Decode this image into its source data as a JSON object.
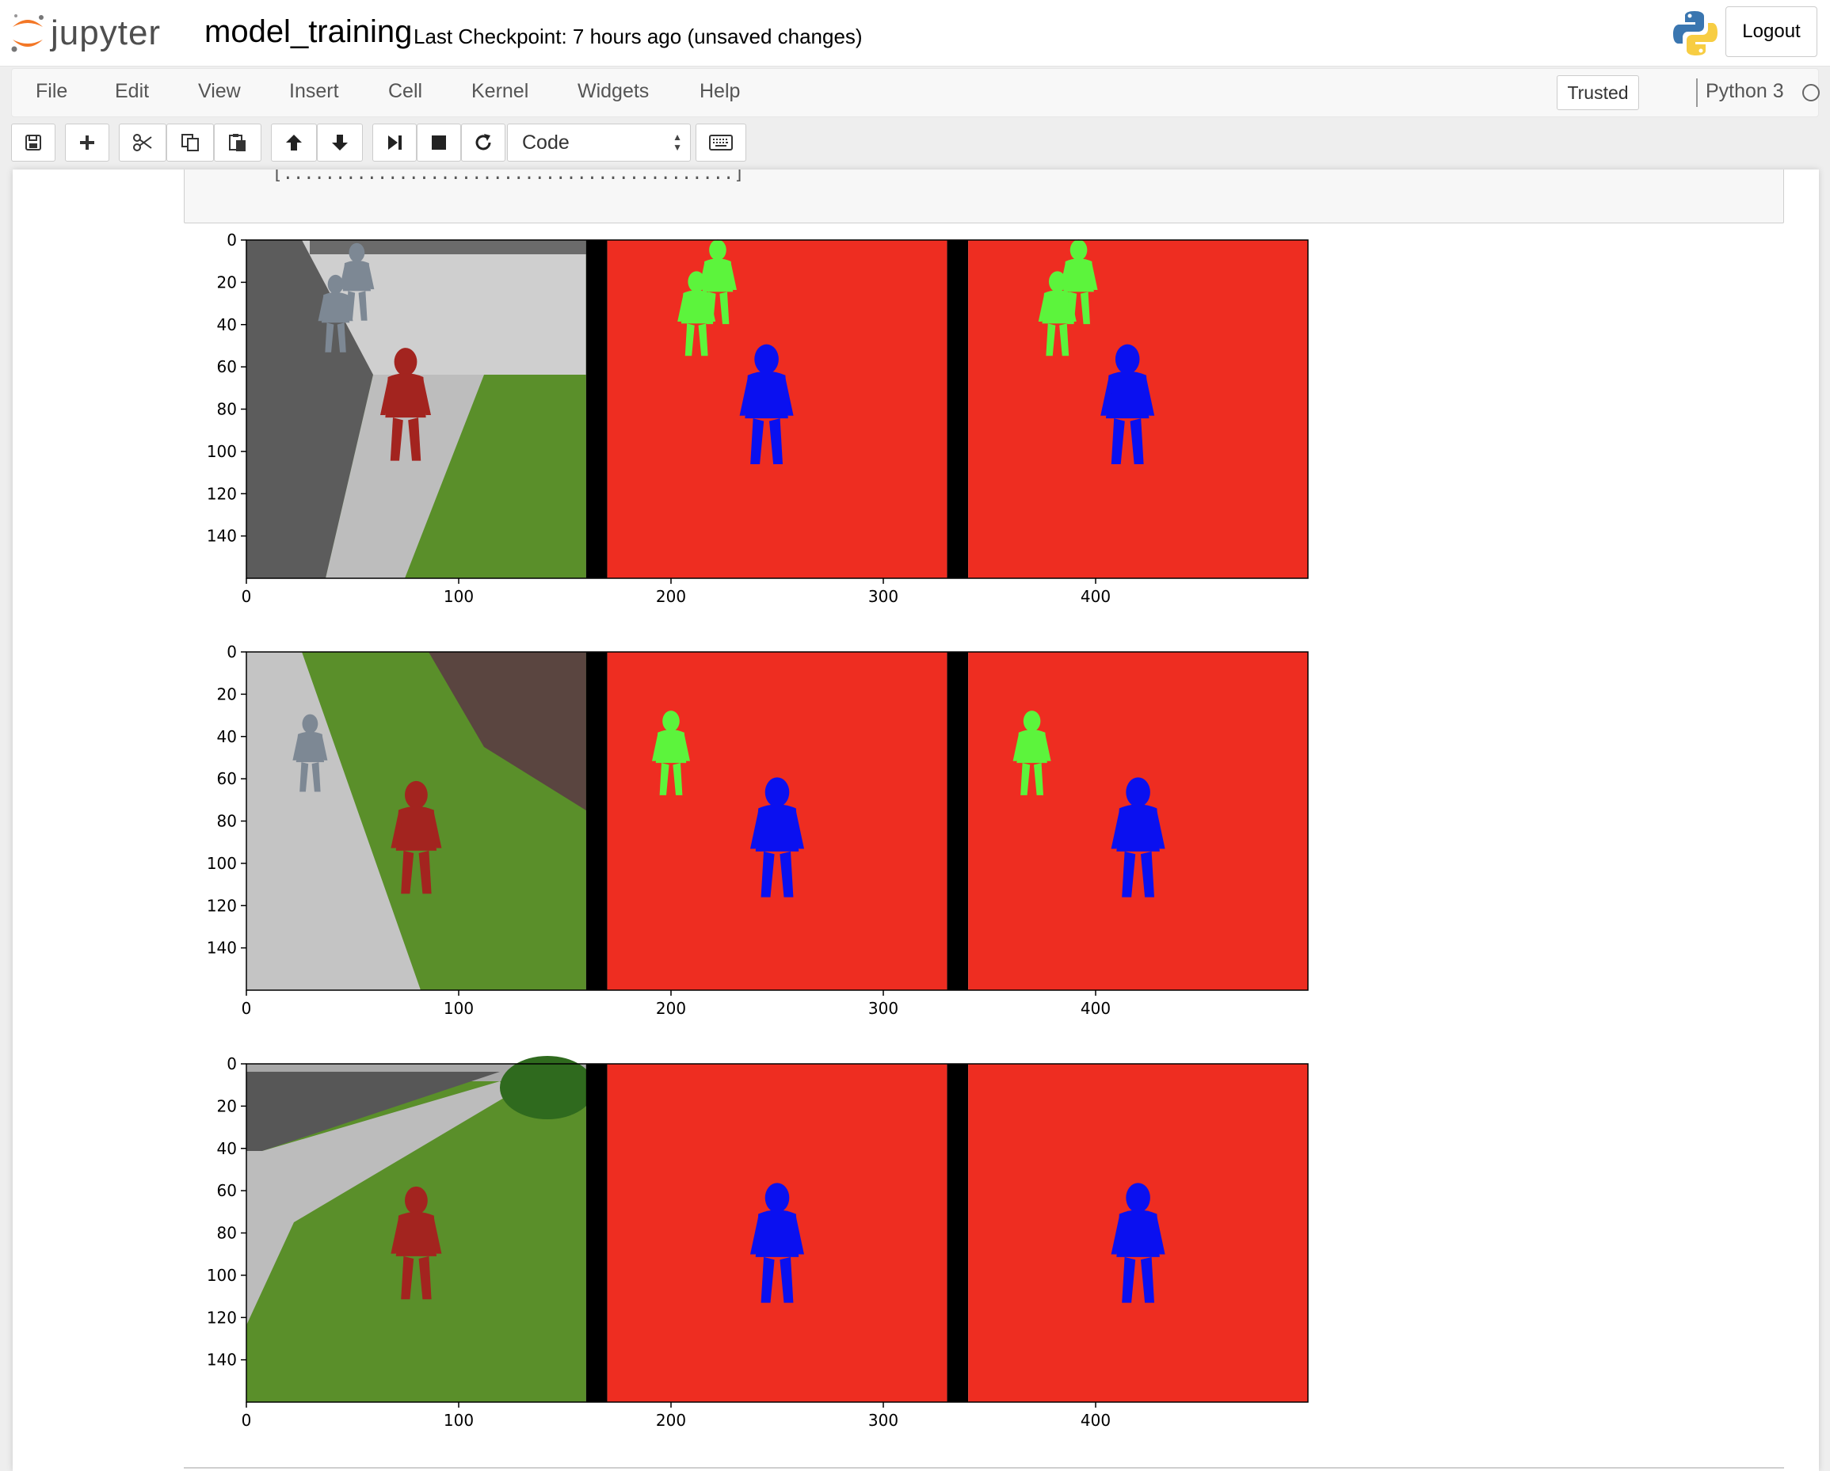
{
  "header": {
    "logo_text": "jupyter",
    "notebook_name": "model_training",
    "checkpoint": "Last Checkpoint: 7 hours ago (unsaved changes)",
    "logout_label": "Logout"
  },
  "menubar": {
    "items": [
      "File",
      "Edit",
      "View",
      "Insert",
      "Cell",
      "Kernel",
      "Widgets",
      "Help"
    ],
    "trusted_label": "Trusted",
    "kernel_name": "Python 3"
  },
  "toolbar": {
    "buttons": [
      "save-icon",
      "plus-icon",
      "scissors-icon",
      "copy-icon",
      "paste-icon",
      "arrow-up-icon",
      "arrow-down-icon",
      "step-forward-icon",
      "stop-icon",
      "refresh-icon",
      "keyboard-icon"
    ],
    "cell_type": "Code"
  },
  "cell": {
    "input_fragment": "  [...........................................]"
  },
  "colors": {
    "mask_background": "#ee2d21",
    "mask_hero": "#0a10f0",
    "mask_other_people": "#5cf43c",
    "separator": "#000000"
  },
  "chart_data": [
    {
      "type": "image",
      "description_panels": [
        "camera image",
        "ground truth mask",
        "prediction"
      ],
      "x_ticks": [
        0,
        100,
        200,
        300,
        400
      ],
      "y_ticks": [
        0,
        20,
        40,
        60,
        80,
        100,
        120,
        140
      ],
      "xlim": [
        0,
        500
      ],
      "ylim": [
        160,
        0
      ]
    },
    {
      "type": "image",
      "x_ticks": [
        0,
        100,
        200,
        300,
        400
      ],
      "y_ticks": [
        0,
        20,
        40,
        60,
        80,
        100,
        120,
        140
      ],
      "xlim": [
        0,
        500
      ],
      "ylim": [
        160,
        0
      ]
    },
    {
      "type": "image",
      "x_ticks": [
        0,
        100,
        200,
        300,
        400
      ],
      "y_ticks": [
        0,
        20,
        40,
        60,
        80,
        100,
        120,
        140
      ],
      "xlim": [
        0,
        500
      ],
      "ylim": [
        160,
        0
      ]
    }
  ]
}
